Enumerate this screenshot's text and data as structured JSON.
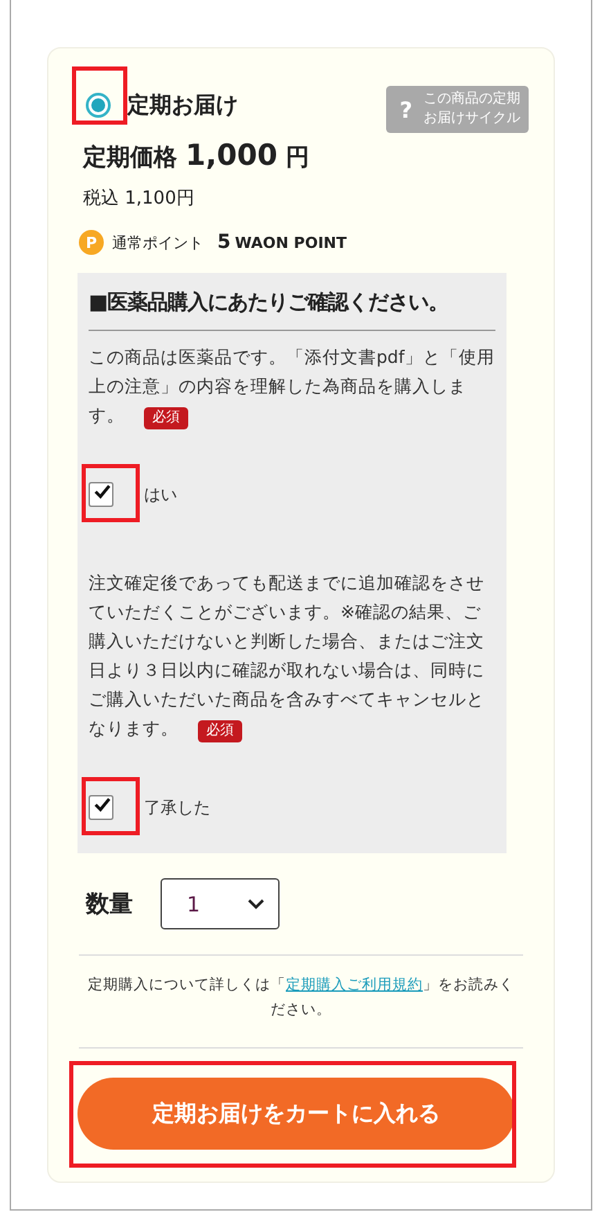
{
  "plan": {
    "label": "定期お届け",
    "selected": true,
    "highlighted": true
  },
  "cycle_button": {
    "icon_text": "?",
    "lines": [
      "この商品の定期",
      "お届けサイクル"
    ]
  },
  "price": {
    "label": "定期価格",
    "amount": "1,000",
    "unit": "円"
  },
  "tax_included": "税込 1,100円",
  "points": {
    "badge": "P",
    "label": "通常ポイント",
    "value": "5",
    "unit": "WAON POINT"
  },
  "confirmation": {
    "title": "■医薬品購入にあたりご確認ください。",
    "items": [
      {
        "text": "この商品は医薬品です。「添付文書pdf」と「使用上の注意」の内容を理解した為商品を購入します。",
        "required_badge": "必須",
        "checkbox_label": "はい",
        "checked": true,
        "highlighted": true
      },
      {
        "text": "注文確定後であっても配送までに追加確認をさせていただくことがございます。※確認の結果、ご購入いただけないと判断した場合、またはご注文日より３日以内に確認が取れない場合は、同時にご購入いただいた商品を含みすべてキャンセルとなります。",
        "required_badge": "必須",
        "checkbox_label": "了承した",
        "checked": true,
        "highlighted": true
      }
    ]
  },
  "quantity": {
    "label": "数量",
    "value": "1"
  },
  "terms_note": {
    "before": "定期購入について詳しくは「",
    "link": "定期購入ご利用規約",
    "after": "」をお読みください。"
  },
  "cart_button": {
    "label": "定期お届けをカートに入れる",
    "highlighted": true
  }
}
